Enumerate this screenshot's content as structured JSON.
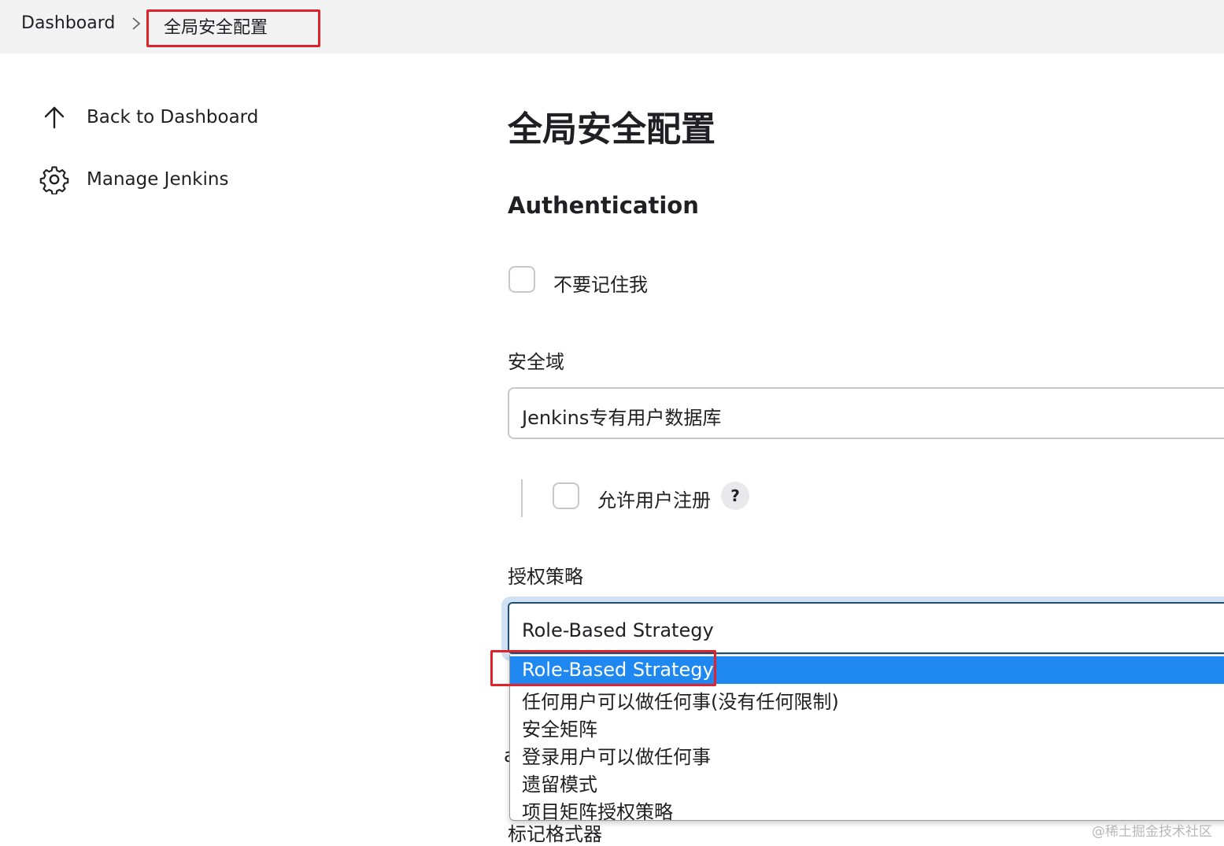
{
  "breadcrumb": {
    "root": "Dashboard",
    "current": "全局安全配置"
  },
  "sidebar": {
    "items": [
      {
        "label": "Back to Dashboard",
        "icon": "arrow-up-icon"
      },
      {
        "label": "Manage Jenkins",
        "icon": "gear-icon"
      }
    ]
  },
  "main": {
    "title": "全局安全配置",
    "section": "Authentication",
    "remember_me_label": "不要记住我",
    "security_realm": {
      "label": "安全域",
      "value": "Jenkins专有用户数据库",
      "allow_signup_label": "允许用户注册",
      "help": "?"
    },
    "authorization": {
      "label": "授权策略",
      "value": "Role-Based Strategy",
      "options": [
        "Role-Based Strategy",
        "任何用户可以做任何事(没有任何限制)",
        "安全矩阵",
        "登录用户可以做任何事",
        "遗留模式",
        "项目矩阵授权策略"
      ],
      "selected_index": 0
    },
    "markup_formatter_label": "标记格式器",
    "peek_char": "a"
  },
  "watermark": "@稀土掘金技术社区",
  "colors": {
    "highlight": "#e0232b",
    "selected_option": "#1e88f0",
    "focus_ring": "#cfe1f2"
  }
}
